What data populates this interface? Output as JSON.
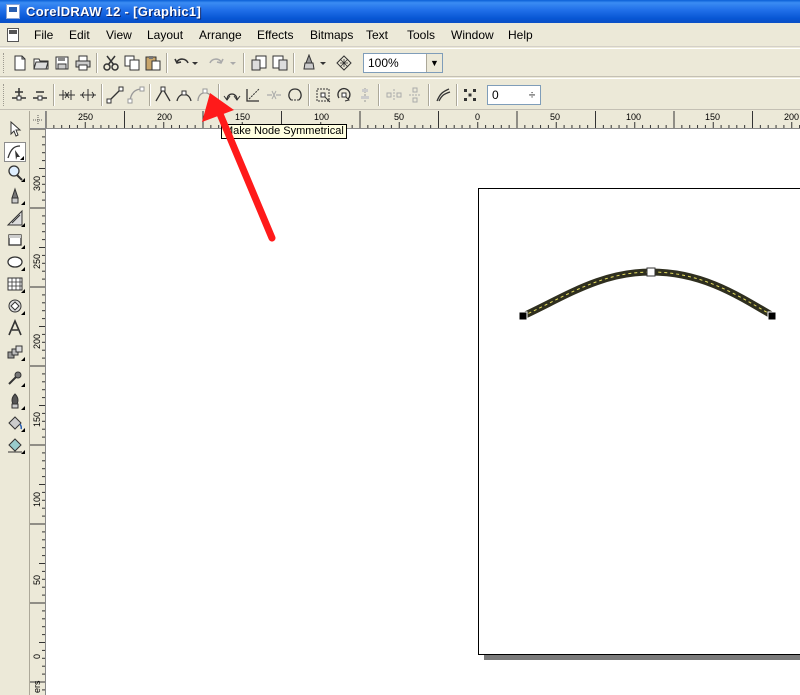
{
  "window": {
    "title": "CorelDRAW 12 - [Graphic1]"
  },
  "menu": [
    "File",
    "Edit",
    "View",
    "Layout",
    "Arrange",
    "Effects",
    "Bitmaps",
    "Text",
    "Tools",
    "Window",
    "Help"
  ],
  "standard_toolbar": {
    "zoom_value": "100%"
  },
  "property_bar": {
    "tooltip": "Make Node Symmetrical",
    "curve_smoothness_value": "0",
    "spinner_glyph": "÷"
  },
  "rulers": {
    "horizontal_labels": [
      "250",
      "200",
      "150",
      "100",
      "50",
      "0",
      "50",
      "100",
      "150",
      "200"
    ],
    "vertical_labels": [
      "300",
      "250",
      "200",
      "150",
      "100",
      "50",
      "0"
    ],
    "units_label": "ers"
  },
  "icons": {
    "toolbox": [
      "pick-tool-icon",
      "shape-tool-icon",
      "zoom-tool-icon",
      "freehand-tool-icon",
      "smart-fill-tool-icon",
      "rectangle-tool-icon",
      "ellipse-tool-icon",
      "graph-paper-tool-icon",
      "basic-shapes-tool-icon",
      "text-tool-icon",
      "interactive-blend-tool-icon",
      "eyedropper-tool-icon",
      "outline-tool-icon",
      "fill-tool-icon",
      "interactive-fill-tool-icon"
    ]
  },
  "colors": {
    "title_bar": "#0a5fd6",
    "annotation_arrow": "#ff1a1a",
    "tooltip_bg": "#ffffe1",
    "curve_outline": "#2f2f1f",
    "curve_dash": "#e8e060"
  }
}
